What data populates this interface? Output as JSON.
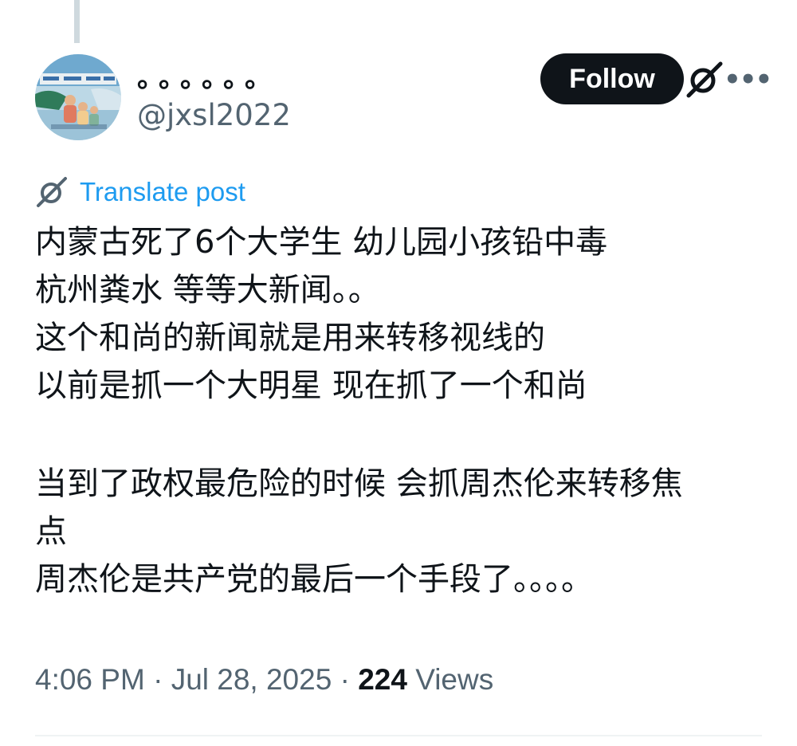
{
  "author": {
    "display_name": "。。。。。。",
    "handle": "@jxsl2022",
    "avatar_icon": "avatar-image"
  },
  "actions": {
    "follow_label": "Follow",
    "grok_icon": "grok-icon",
    "more_icon": "more-options-icon",
    "more_glyph": "•••"
  },
  "translate": {
    "label": "Translate post",
    "icon": "grok-translate-icon"
  },
  "post": {
    "lines": [
      "内蒙古死了6个大学生  幼儿园小孩铅中毒",
      "杭州粪水 等等大新闻。。",
      "这个和尚的新闻就是用来转移视线的",
      "以前是抓一个大明星  现在抓了一个和尚",
      "",
      "当到了政权最危险的时候  会抓周杰伦来转移焦",
      "点",
      "周杰伦是共产党的最后一个手段了。。。。"
    ]
  },
  "meta": {
    "time": "4:06 PM",
    "separator": "·",
    "date": "Jul 28, 2025",
    "views_count": "224",
    "views_label": "Views"
  },
  "colors": {
    "text_primary": "#0f1419",
    "text_secondary": "#536471",
    "accent": "#1d9bf0",
    "follow_bg": "#0f1419",
    "divider": "#eff3f4"
  }
}
